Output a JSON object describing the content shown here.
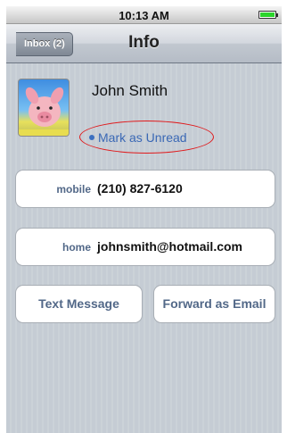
{
  "status_bar": {
    "time": "10:13 AM"
  },
  "nav": {
    "back_label": "Inbox (2)",
    "title": "Info"
  },
  "contact": {
    "name": "John Smith",
    "mark_unread_label": "Mark as Unread"
  },
  "fields": [
    {
      "label": "mobile",
      "value": "(210) 827-6120"
    },
    {
      "label": "home",
      "value": "johnsmith@hotmail.com"
    }
  ],
  "actions": {
    "text_message": "Text Message",
    "forward_email": "Forward as Email"
  }
}
